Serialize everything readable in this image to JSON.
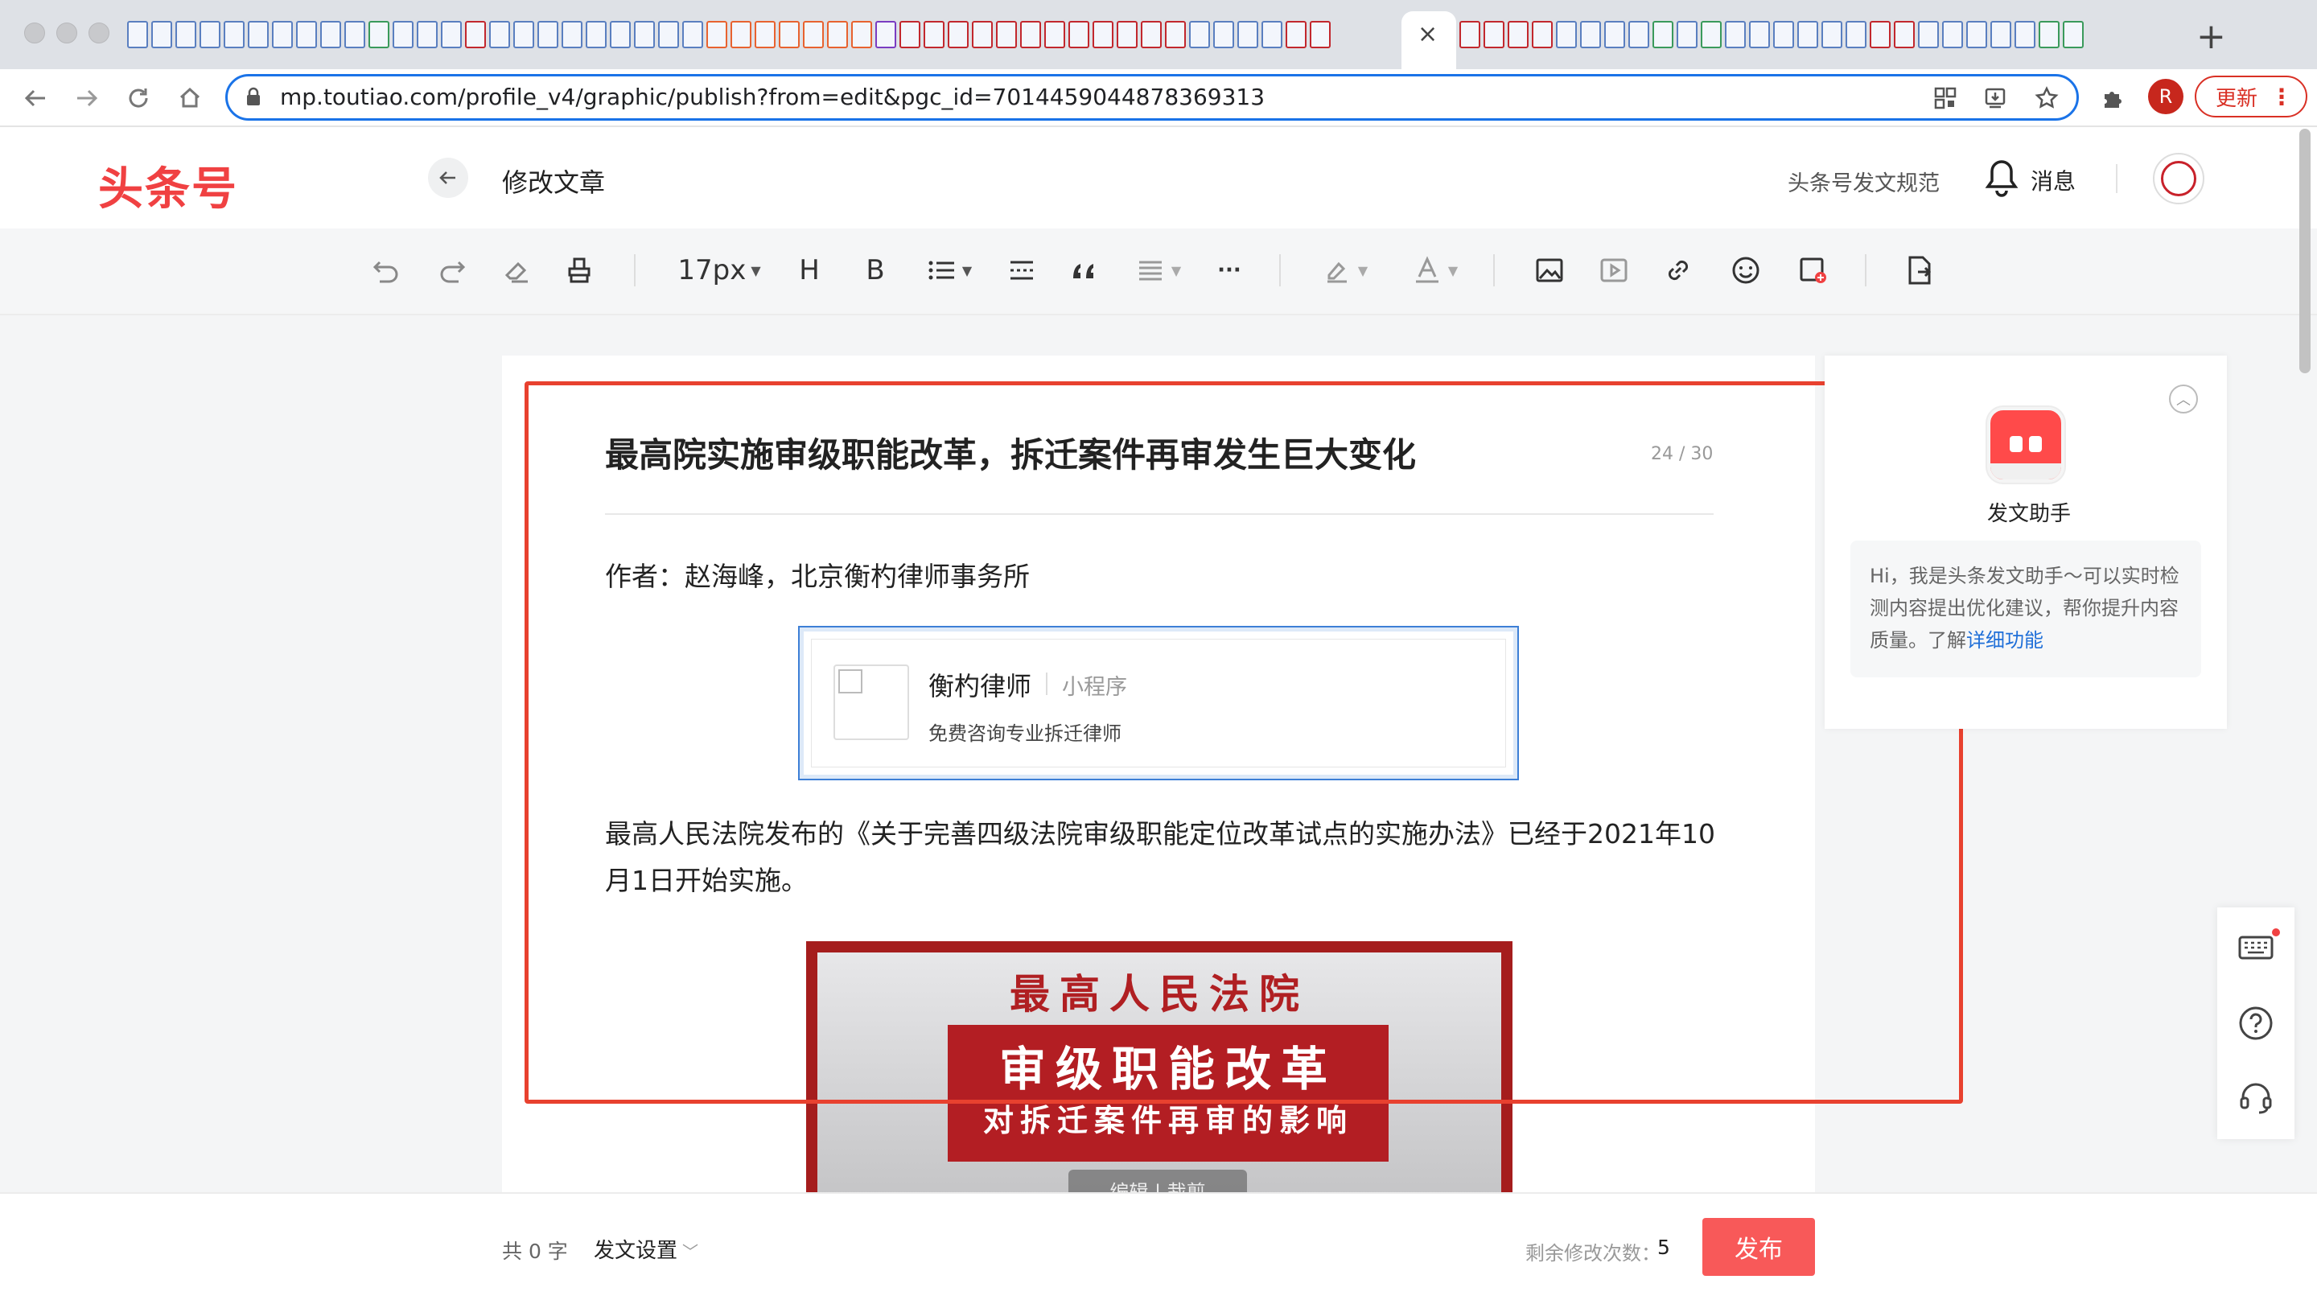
{
  "browser": {
    "url": "mp.toutiao.com/profile_v4/graphic/publish?from=edit&pgc_id=7014459044878369313",
    "tab_close": "×",
    "new_tab": "+",
    "profile_initial": "R",
    "update_label": "更新"
  },
  "header": {
    "logo": "头条号",
    "page_title": "修改文章",
    "rules_link": "头条号发文规范",
    "messages_label": "消息"
  },
  "toolbar": {
    "font_size": "17px",
    "heading_label": "H",
    "bold_label": "B",
    "more_label": "···"
  },
  "article": {
    "title": "最高院实施审级职能改革，拆迁案件再审发生巨大变化",
    "title_count": "24 / 30",
    "author_line": "作者：赵海峰，北京衡杓律师事务所",
    "mini_program": {
      "name": "衡杓律师",
      "type": "小程序",
      "desc": "免费咨询专业拆迁律师"
    },
    "paragraph": "最高人民法院发布的《关于完善四级法院审级职能定位改革试点的实施办法》已经于2021年10月1日开始实施。",
    "banner": {
      "heading": "最高人民法院",
      "main": "审级职能改革",
      "sub": "对拆迁案件再审的影响",
      "image_tools": "编辑 | 裁剪"
    }
  },
  "assistant": {
    "name": "发文助手",
    "message": "Hi，我是头条发文助手～可以实时检测内容提出优化建议，帮你提升内容质量。了解",
    "link": "详细功能"
  },
  "footer": {
    "word_count": "共 0 字",
    "settings_label": "发文设置",
    "remaining_label": "剩余修改次数：",
    "remaining_count": "5",
    "publish_label": "发布"
  },
  "colors": {
    "brand": "#f04142",
    "highlight": "#e8412f",
    "publish": "#f85959",
    "link": "#1f6fd8"
  }
}
